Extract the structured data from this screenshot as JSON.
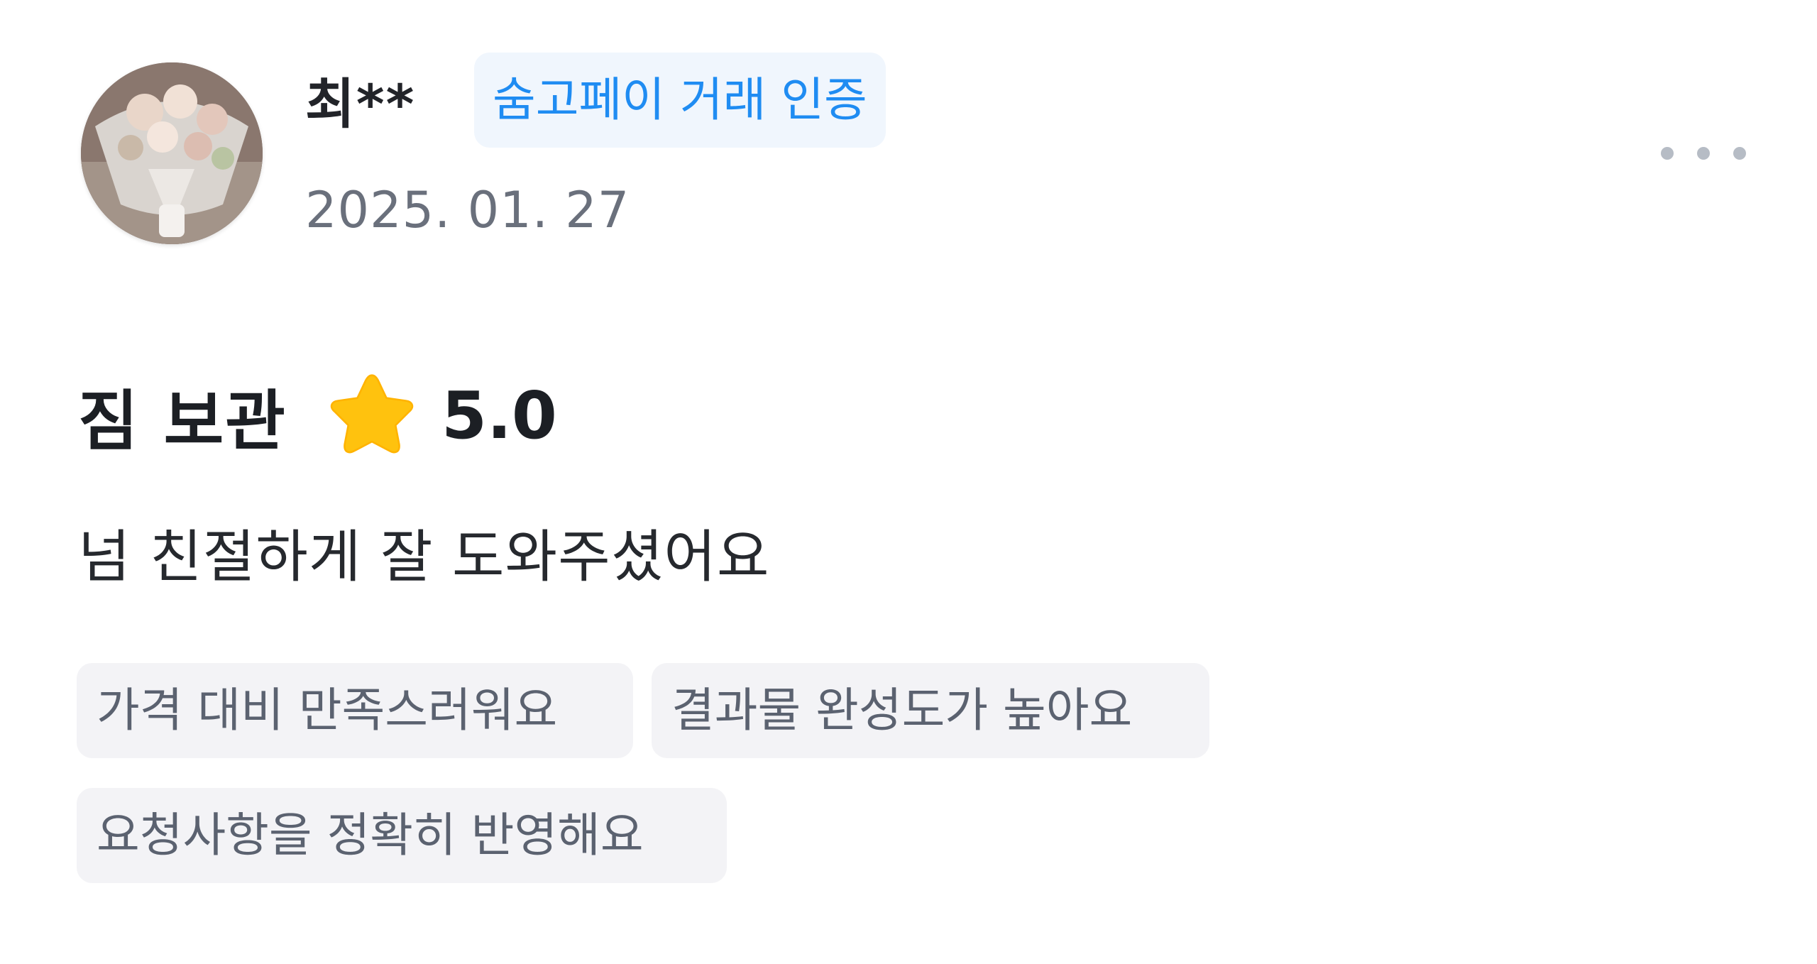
{
  "reviewer": {
    "name": "최**",
    "badge": "숨고페이 거래 인증",
    "date": "2025. 01. 27",
    "avatar": "bouquet-photo"
  },
  "review": {
    "service": "짐 보관",
    "rating": "5.0",
    "text": "넘 친절하게 잘 도와주셨어요",
    "tags": [
      "가격 대비 만족스러워요",
      "결과물 완성도가 높아요",
      "요청사항을 정확히 반영해요"
    ]
  },
  "icons": {
    "star": "star-icon",
    "more": "more-options-icon"
  },
  "colors": {
    "badge_text": "#1f8cf2",
    "badge_bg": "#f0f6fd",
    "star": "#ffc20e",
    "tag_bg": "#f3f3f6",
    "tag_text": "#5b6270",
    "date_text": "#6a707c"
  }
}
